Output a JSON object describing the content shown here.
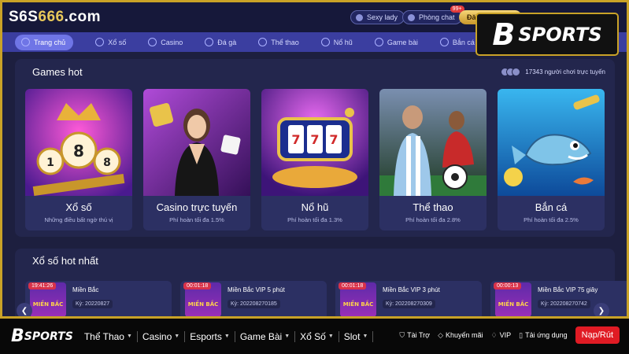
{
  "site": {
    "logo_prefix": "S6S",
    "logo_main": "666",
    "logo_suffix": ".com"
  },
  "header": {
    "pills": [
      {
        "label": "Sexy lady",
        "icon": "heart-icon"
      },
      {
        "label": "Phòng chat",
        "icon": "chat-icon",
        "badge": "99+"
      }
    ],
    "gold_button": "Đă"
  },
  "nav": {
    "items": [
      {
        "label": "Trang chủ",
        "icon": "home-icon",
        "active": true
      },
      {
        "label": "Xổ số",
        "icon": "lottery-icon"
      },
      {
        "label": "Casino",
        "icon": "casino-icon"
      },
      {
        "label": "Đá gà",
        "icon": "rooster-icon"
      },
      {
        "label": "Thể thao",
        "icon": "soccer-icon"
      },
      {
        "label": "Nổ hũ",
        "icon": "slot-icon"
      },
      {
        "label": "Game bài",
        "icon": "cards-icon"
      },
      {
        "label": "Bắn cá",
        "icon": "fish-icon"
      }
    ]
  },
  "games_hot": {
    "title": "Games hot",
    "online_text": "17343 người chơi trực tuyến",
    "cards": [
      {
        "name": "Xổ số",
        "sub": "Những điều bất ngờ thú vị"
      },
      {
        "name": "Casino trực tuyến",
        "sub": "Phí hoàn tối đa 1.5%"
      },
      {
        "name": "Nổ hũ",
        "sub": "Phí hoàn tối đa 1.3%"
      },
      {
        "name": "Thể thao",
        "sub": "Phí hoàn tối đa 2.8%"
      },
      {
        "name": "Bắn cá",
        "sub": "Phí hoàn tối đa 2.5%"
      }
    ]
  },
  "lottery_hot": {
    "title": "Xổ số hot nhất",
    "thumb_label": "MIỀN BẮC",
    "items": [
      {
        "timer": "19:41:26",
        "title": "Miền Bắc",
        "ky": "Kỳ: 20220827"
      },
      {
        "timer": "00:01:18",
        "title": "Miền Bắc VIP 5 phút",
        "ky": "Kỳ: 202208270185"
      },
      {
        "timer": "00:01:18",
        "title": "Miền Bắc VIP 3 phút",
        "ky": "Kỳ: 202208270309"
      },
      {
        "timer": "00:00:13",
        "title": "Miền Bắc VIP 75 giây",
        "ky": "Kỳ: 202208270742"
      }
    ]
  },
  "brand": {
    "mark": "B",
    "word": "SPORTS"
  },
  "footer": {
    "nav": [
      "Thể Thao",
      "Casino",
      "Esports",
      "Game Bài",
      "Xổ Số",
      "Slot"
    ],
    "right": [
      {
        "label": "Tài Trợ",
        "icon": "shield-icon"
      },
      {
        "label": "Khuyến mãi",
        "icon": "tag-icon"
      },
      {
        "label": "VIP",
        "icon": "diamond-icon"
      },
      {
        "label": "Tải ứng dụng",
        "icon": "phone-icon"
      }
    ],
    "cta": "Nạp/Rút"
  },
  "colors": {
    "accent": "#c9a227",
    "nav": "#3b3ea0",
    "panel": "#23264d",
    "cta": "#e01b24"
  }
}
